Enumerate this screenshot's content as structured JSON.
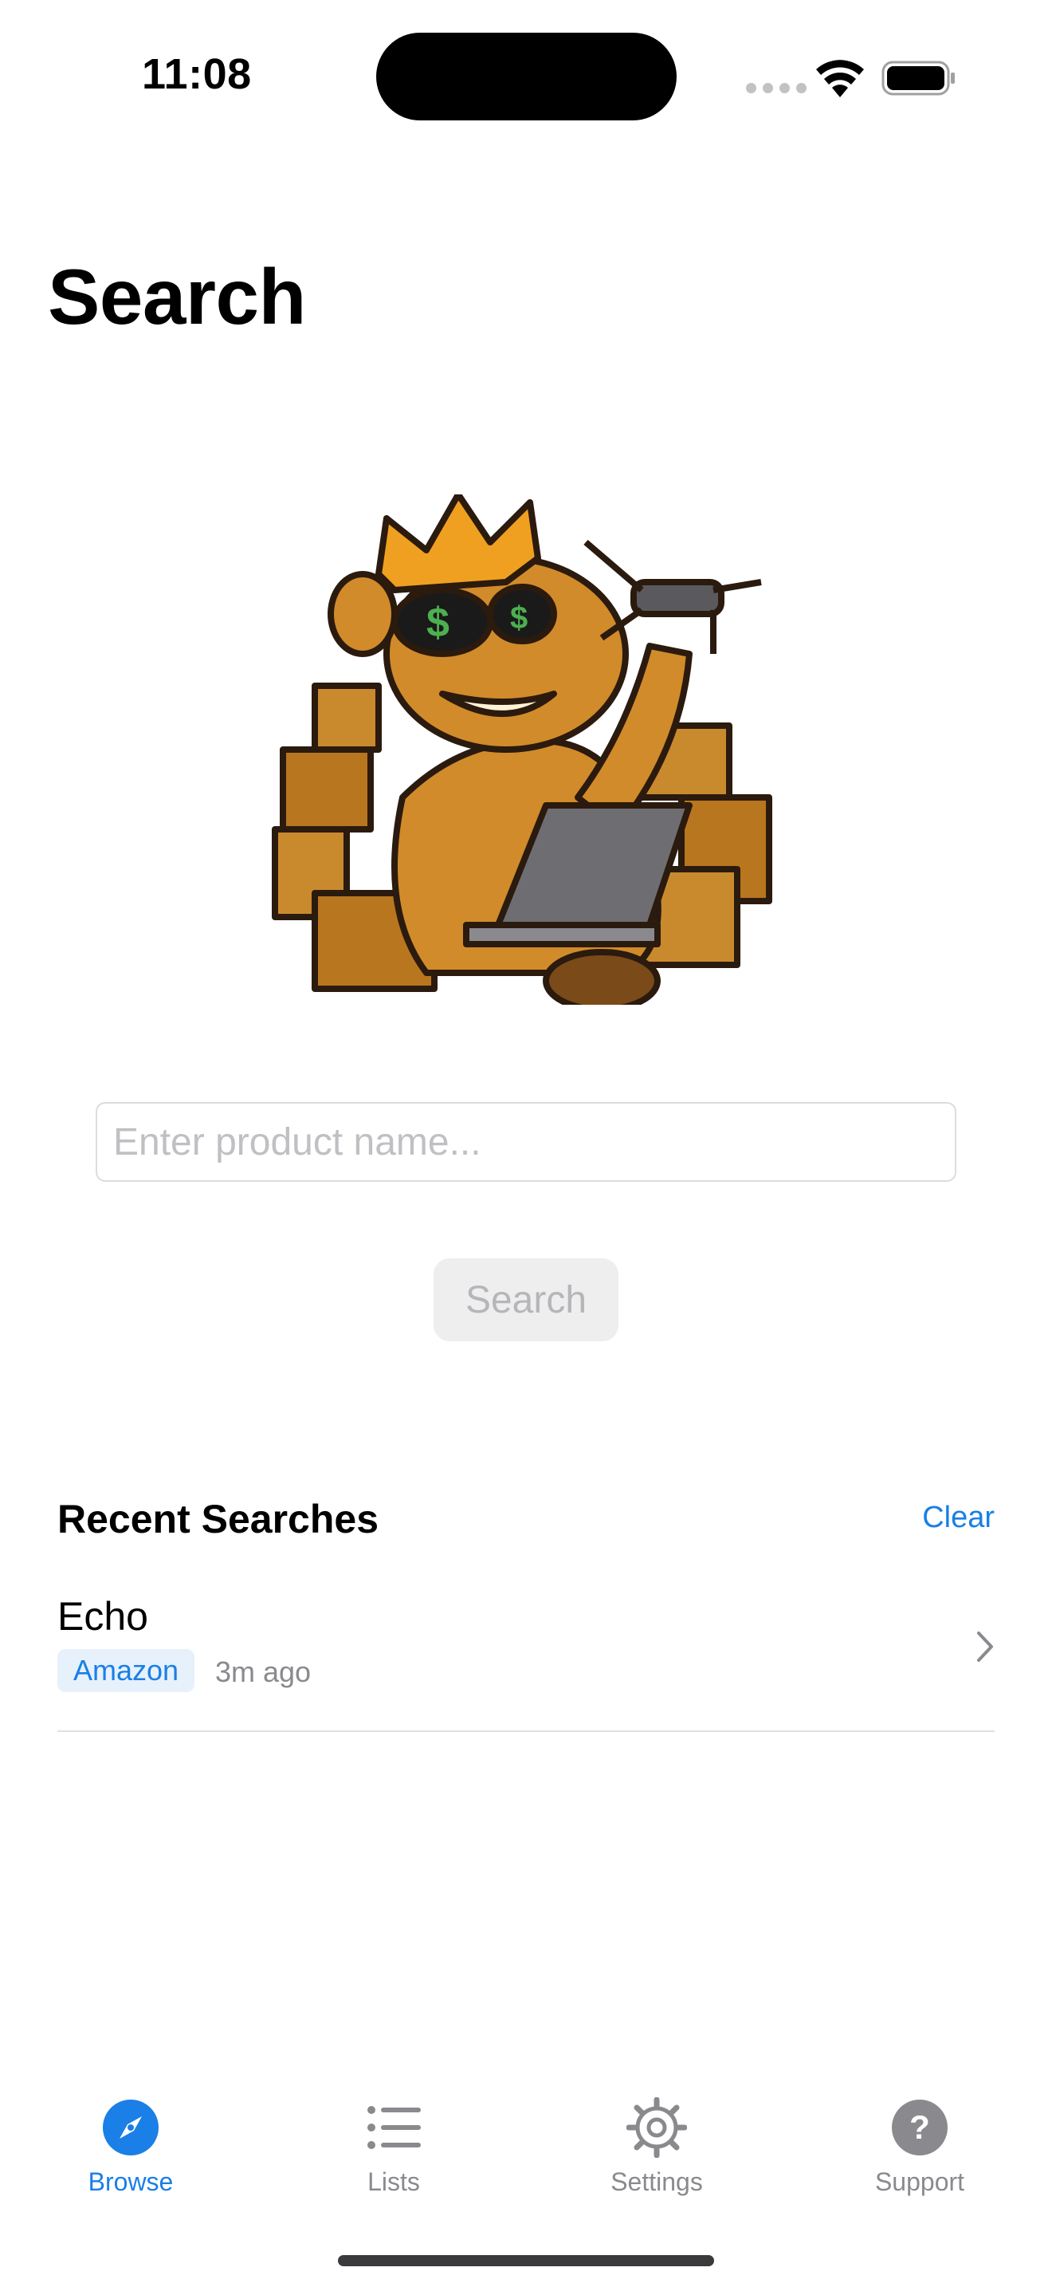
{
  "status_bar": {
    "time": "11:08"
  },
  "page": {
    "title": "Search"
  },
  "search": {
    "placeholder": "Enter product name...",
    "button_label": "Search"
  },
  "recent": {
    "title": "Recent Searches",
    "clear_label": "Clear",
    "items": [
      {
        "name": "Echo",
        "store": "Amazon",
        "time": "3m ago"
      }
    ]
  },
  "tabs": [
    {
      "label": "Browse",
      "icon": "compass-icon",
      "active": true
    },
    {
      "label": "Lists",
      "icon": "list-icon",
      "active": false
    },
    {
      "label": "Settings",
      "icon": "gear-icon",
      "active": false
    },
    {
      "label": "Support",
      "icon": "question-icon",
      "active": false
    }
  ],
  "colors": {
    "accent": "#1a7fe6",
    "inactive": "#8a8a8e",
    "badge_bg": "#e6f1fc"
  }
}
